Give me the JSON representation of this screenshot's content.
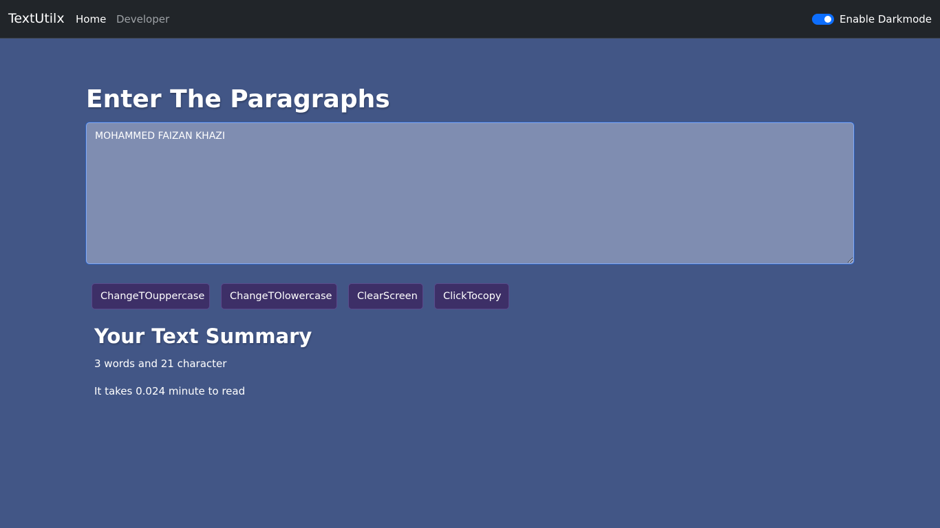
{
  "navbar": {
    "brand": "TextUtilx",
    "links": [
      {
        "label": "Home",
        "active": true
      },
      {
        "label": "Developer",
        "active": false
      }
    ],
    "darkmode_toggle": {
      "label": "Enable Darkmode",
      "checked": true
    }
  },
  "main": {
    "heading": "Enter The Paragraphs",
    "textarea_value": "MOHAMMED FAIZAN KHAZI",
    "buttons": {
      "uppercase": "ChangeTOuppercase",
      "lowercase": "ChangeTOlowercase",
      "clear": "ClearScreen",
      "copy": "ClickTocopy"
    }
  },
  "summary": {
    "title": "Your Text Summary",
    "counts": "3 words and 21 character",
    "read_time": "It takes 0.024 minute to read"
  },
  "colors": {
    "background": "#425686",
    "navbar": "#212529",
    "textarea": "#7f8db1",
    "button": "#3d2f67",
    "toggle_accent": "#0d6efd"
  }
}
